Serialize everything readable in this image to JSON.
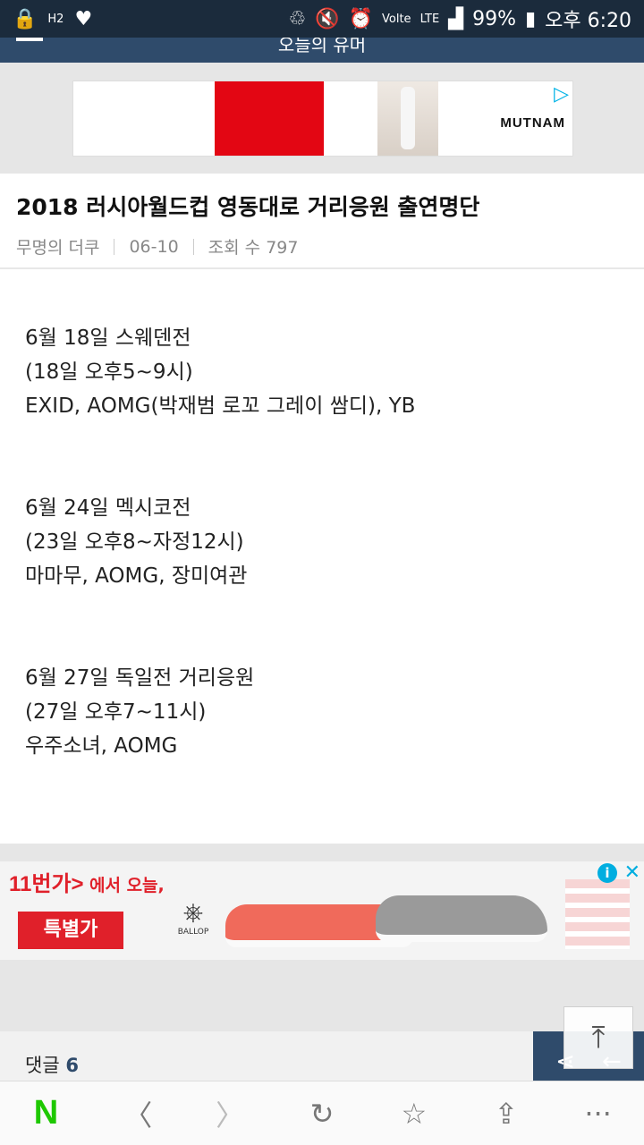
{
  "status_bar": {
    "battery": "99%",
    "time": "오후 6:20",
    "network": "LTE",
    "volte": "Volte"
  },
  "app_bar": {
    "title": "오늘의 유머"
  },
  "top_ad": {
    "brand": "MUTNAM"
  },
  "post": {
    "title": "2018 러시아월드컵 영동대로 거리응원 출연명단",
    "author": "무명의 더쿠",
    "date": "06-10",
    "views": "조회 수 797",
    "blocks": [
      {
        "line1": "6월 18일 스웨덴전",
        "line2": "(18일 오후5~9시)",
        "line3": "EXID, AOMG(박재범 로꼬 그레이 쌈디), YB"
      },
      {
        "line1": "6월 24일 멕시코전",
        "line2": "(23일 오후8~자정12시)",
        "line3": "마마무, AOMG, 장미여관"
      },
      {
        "line1": "6월 27일 독일전 거리응원",
        "line2": "(27일 오후7~11시)",
        "line3": "우주소녀, AOMG"
      }
    ]
  },
  "bottom_ad": {
    "logo": "11번가",
    "slogan": "에서 오늘,",
    "button": "특별가",
    "brand": "BALLOP"
  },
  "comments": {
    "label": "댓글",
    "count": "6"
  },
  "colors": {
    "header": "#2f4b6b",
    "status": "#1b2b3c",
    "naver_green": "#1ec800",
    "ad_red": "#e0202a"
  }
}
